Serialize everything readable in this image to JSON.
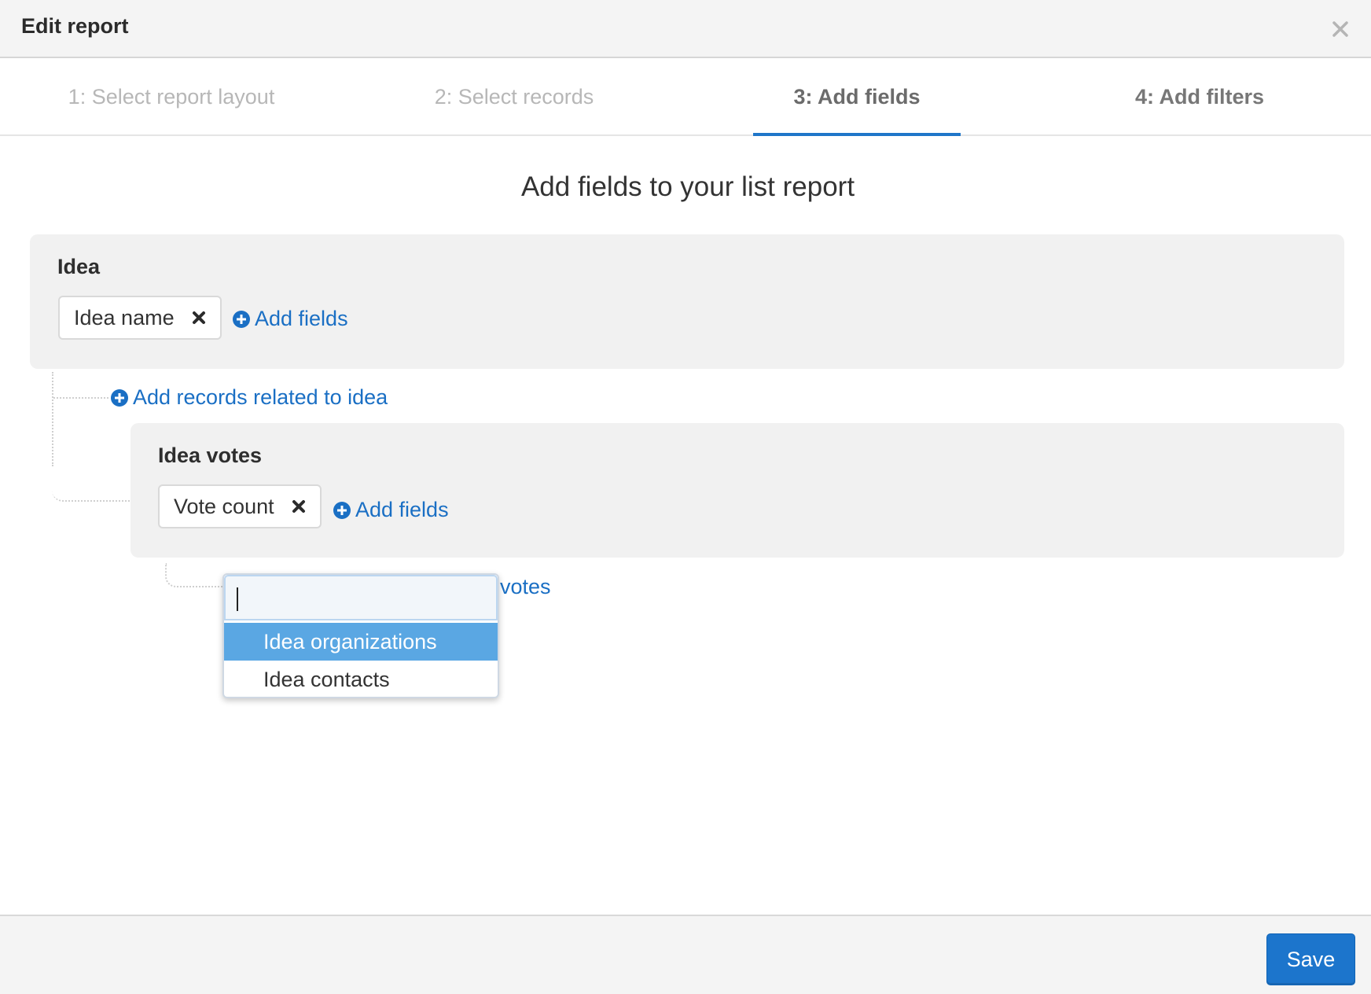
{
  "header": {
    "title": "Edit report",
    "close_icon": "close-icon"
  },
  "tabs": [
    {
      "label": "1: Select report layout",
      "state": "visited"
    },
    {
      "label": "2: Select records",
      "state": "visited"
    },
    {
      "label": "3: Add fields",
      "state": "active"
    },
    {
      "label": "4: Add filters",
      "state": "upcoming"
    }
  ],
  "main": {
    "title": "Add fields to your list report"
  },
  "idea_panel": {
    "title": "Idea",
    "fields": [
      {
        "label": "Idea name"
      }
    ],
    "add_fields_label": "Add fields",
    "add_related_label": "Add records related to idea"
  },
  "votes_panel": {
    "title": "Idea votes",
    "fields": [
      {
        "label": "Vote count"
      }
    ],
    "add_fields_label": "Add fields",
    "add_related_visible": "votes"
  },
  "dropdown": {
    "search_value": "",
    "options": [
      "Idea organizations",
      "Idea contacts"
    ],
    "highlighted": "Idea organizations"
  },
  "footer": {
    "save_label": "Save"
  },
  "colors": {
    "accent": "#1c75cc",
    "link": "#1a6fc4",
    "highlight": "#5aa7e3",
    "panel_bg": "#f1f1f1"
  }
}
